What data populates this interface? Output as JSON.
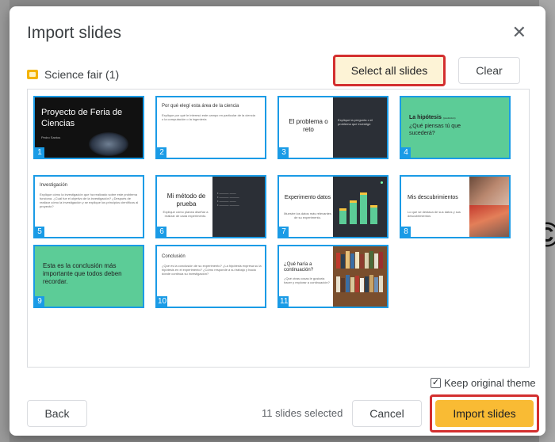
{
  "dialog": {
    "title": "Import slides",
    "close_icon": "close-icon",
    "deck_name": "Science fair (1)",
    "select_all_label": "Select all slides",
    "clear_label": "Clear",
    "back_label": "Back",
    "cancel_label": "Cancel",
    "import_label": "Import slides",
    "selected_count": "11 slides selected",
    "keep_theme_label": "Keep original theme",
    "keep_theme_checked": true
  },
  "colors": {
    "accent_blue": "#1a9be6",
    "highlight_red": "#d32f2f",
    "import_yellow": "#f9bb34",
    "slide_green": "#5ccc97"
  },
  "slides": [
    {
      "num": "1",
      "title": "Proyecto de Feria de Ciencias",
      "sub": "Pedro Santos"
    },
    {
      "num": "2",
      "title": "Por qué elegí esta área de la ciencia",
      "body": "Explique por qué le interesó este campo en particular de la ciencia o la computación o la ingeniería"
    },
    {
      "num": "3",
      "title": "El problema o reto",
      "body": "Explique la pregunta o el problema que investigó"
    },
    {
      "num": "4",
      "title": "La hipótesis",
      "title_note": "(predicción)",
      "body": "¿Qué piensas tú que sucederá?"
    },
    {
      "num": "5",
      "title": "Investigación",
      "body": "Explique cómo la investigación que ha realizado sobre este problema funciona. ¿Cuál fue el objetivo de la investigación? ¿Después de realizar cómo la investigación y se explique los principios científicos al proyecto?"
    },
    {
      "num": "6",
      "title": "Mi método de prueba",
      "body": "Explique cómo planea diseñar a realizar de cada experimento."
    },
    {
      "num": "7",
      "title": "Experimento datos",
      "body": "Muestre los datos más relevantes de su experimento."
    },
    {
      "num": "8",
      "title": "Mis descubrimientos",
      "body": "Lo que se destaca de sus datos y sus descubrimientos"
    },
    {
      "num": "9",
      "title": "Esta es la conclusión más importante que todos deben recordar."
    },
    {
      "num": "10",
      "title": "Conclusión",
      "body": "¿Qué es la conclusión de su experimento? ¿La hipótesis expresa su la hipótesis en el experimento? ¿Cómo responde a su trabajo y hacia dónde continúa su investigación?"
    },
    {
      "num": "11",
      "title": "¿Qué haría a continuación?",
      "body": "¿Qué otras cosas le gustaría hacer y explorar a continuación?"
    }
  ]
}
